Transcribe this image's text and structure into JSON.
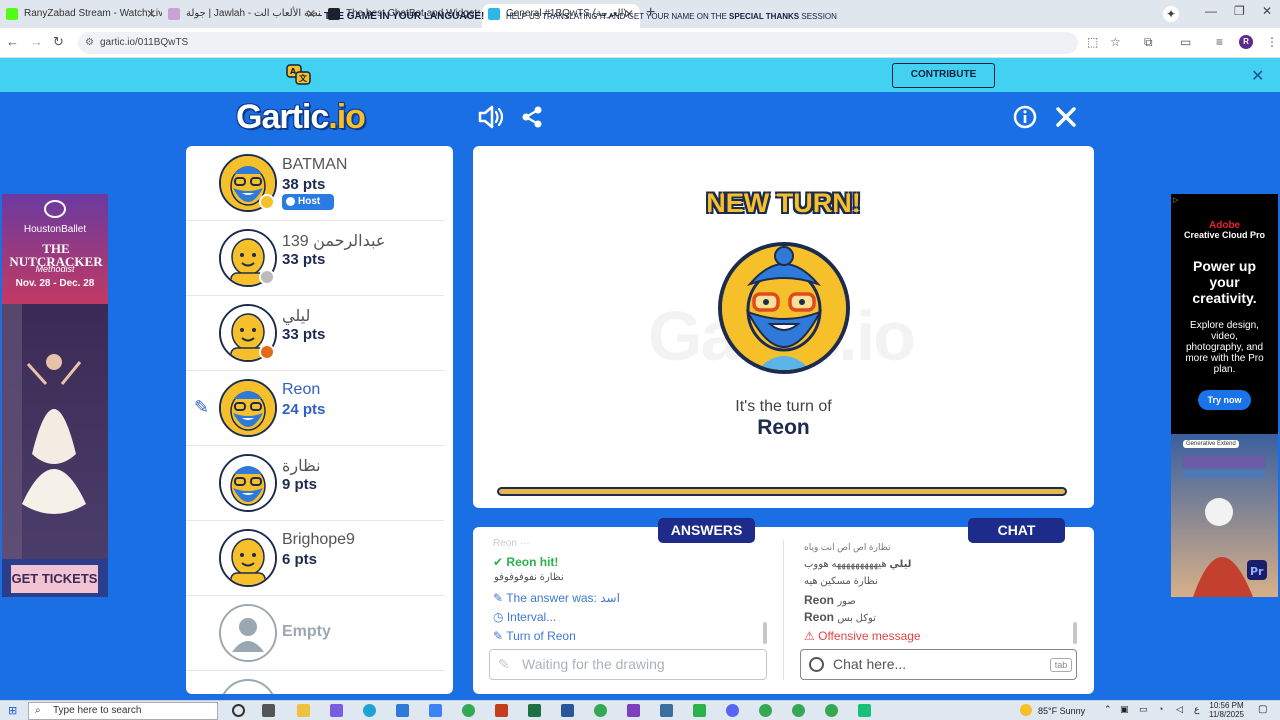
{
  "browser": {
    "tabs": [
      {
        "title": "RanyZabad Stream - Watch Liv",
        "favicon_color": "#53fc18"
      },
      {
        "title": "جولة | Jawlah - منصة الألعاب الت",
        "favicon_color": "#c9a3d6"
      },
      {
        "title": "The best ChatBot and Widgets",
        "favicon_color": "#222222"
      },
      {
        "title": "General #1BQwTS (العربية)",
        "favicon_color": "#2db6e8"
      }
    ],
    "url": "gartic.io/011BQwTS"
  },
  "banner": {
    "title": "THE GAME IN YOUR LANGUAGE!",
    "text_before": "HELP US TRANSLATING IT AND GET YOUR NAME ON THE",
    "text_bold": "SPECIAL THANKS",
    "text_after": "SESSION",
    "button": "CONTRIBUTE"
  },
  "logo": {
    "main": "Gartic",
    "suffix": ".io"
  },
  "players": [
    {
      "name": "BATMAN",
      "pts": "38 pts",
      "host": "Host",
      "dot": "#f6c02b",
      "avatar": "bearded"
    },
    {
      "name": "عبدالرحمن 139",
      "pts": "33 pts",
      "dot": "#bbbbbb",
      "avatar": "bald"
    },
    {
      "name": "ليلي",
      "pts": "33 pts",
      "dot": "#e36a1b",
      "avatar": "bald"
    },
    {
      "name": "Reon",
      "pts": "24 pts",
      "dot": "",
      "avatar": "bearded",
      "active": true
    },
    {
      "name": "نظارة",
      "pts": "9 pts",
      "dot": "",
      "avatar": "bearded"
    },
    {
      "name": "Brighope9",
      "pts": "6 pts",
      "dot": "",
      "avatar": "bald"
    },
    {
      "name": "Empty",
      "pts": "",
      "dot": "",
      "avatar": "empty"
    }
  ],
  "turn": {
    "heading": "NEW TURN!",
    "subtitle": "It's the turn of",
    "player": "Reon",
    "watermark": "Gartic.io"
  },
  "answers": {
    "tab": "ANSWERS",
    "messages": [
      {
        "text": "Reon hit!",
        "type": "hit"
      },
      {
        "text": "نظارة نفوفوفوفو",
        "type": "guess"
      },
      {
        "text": "The answer was: اسد",
        "type": "info"
      },
      {
        "text": "Interval...",
        "type": "info"
      },
      {
        "text": "Turn of Reon",
        "type": "info"
      }
    ],
    "input_placeholder": "Waiting for the drawing"
  },
  "chat": {
    "tab": "CHAT",
    "messages": [
      {
        "user": "",
        "text": "نظارة اص اص انت وياه"
      },
      {
        "user": "ليلي",
        "text": "هيهههههههههه هووب"
      },
      {
        "user": "",
        "text": "نظارة مسكين هيه"
      },
      {
        "user": "Reon",
        "text": "صور"
      },
      {
        "user": "Reon",
        "text": "توكل بس"
      },
      {
        "user": "",
        "text": "Offensive message",
        "warn": true
      }
    ],
    "input_placeholder": "Chat here...",
    "tab_hint": "tab"
  },
  "ad_left": {
    "brand": "HoustonBallet",
    "title": "THE NUTCRACKER",
    "sponsor": "Methodist",
    "dates": "Nov. 28 - Dec. 28",
    "cta": "GET TICKETS"
  },
  "ad_right": {
    "brand": "Adobe",
    "product": "Creative Cloud Pro",
    "headline": "Power up your creativity.",
    "body": "Explore design, video, photography, and more with the Pro plan.",
    "cta": "Try now",
    "tag": "Generative Extend"
  },
  "taskbar": {
    "search": "Type here to search",
    "weather": "85°F  Sunny",
    "time": "10:56 PM",
    "date": "11/8/2025"
  },
  "colors": {
    "primary_blue": "#1b6fe5",
    "banner": "#43d1f1",
    "yellow": "#f6c02b",
    "navy": "#1d2b4f"
  }
}
